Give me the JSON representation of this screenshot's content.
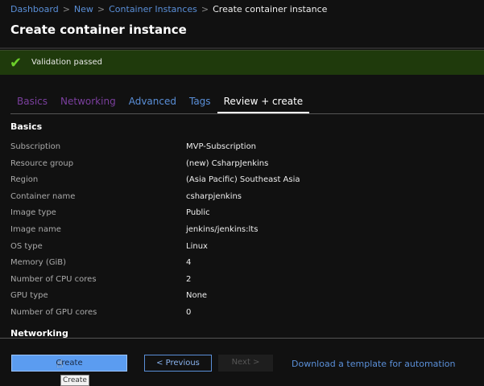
{
  "breadcrumb": [
    "Dashboard",
    "New",
    "Container Instances",
    "Create container instance"
  ],
  "title": "Create container instance",
  "banner": {
    "text": "Validation passed",
    "icon": "checkmark-icon"
  },
  "tabs": [
    {
      "label": "Basics",
      "color": "#7b3f9e"
    },
    {
      "label": "Networking",
      "color": "#7b3f9e"
    },
    {
      "label": "Advanced",
      "color": "#5a8fd8"
    },
    {
      "label": "Tags",
      "color": "#5a8fd8"
    },
    {
      "label": "Review + create",
      "color": "#ffffff",
      "active": true
    }
  ],
  "basics": {
    "heading": "Basics",
    "rows": [
      [
        "Subscription",
        "MVP-Subscription"
      ],
      [
        "Resource group",
        "(new) CsharpJenkins"
      ],
      [
        "Region",
        "(Asia Pacific) Southeast Asia"
      ],
      [
        "Container name",
        "csharpjenkins"
      ],
      [
        "Image type",
        "Public"
      ],
      [
        "Image name",
        "jenkins/jenkins:lts"
      ],
      [
        "OS type",
        "Linux"
      ],
      [
        "Memory (GiB)",
        "4"
      ],
      [
        "Number of CPU cores",
        "2"
      ],
      [
        "GPU type",
        "None"
      ],
      [
        "Number of GPU cores",
        "0"
      ]
    ]
  },
  "networking": {
    "heading": "Networking"
  },
  "footer": {
    "create": "Create",
    "previous": "< Previous",
    "next": "Next >",
    "download": "Download a template for automation",
    "tooltip": "Create"
  }
}
